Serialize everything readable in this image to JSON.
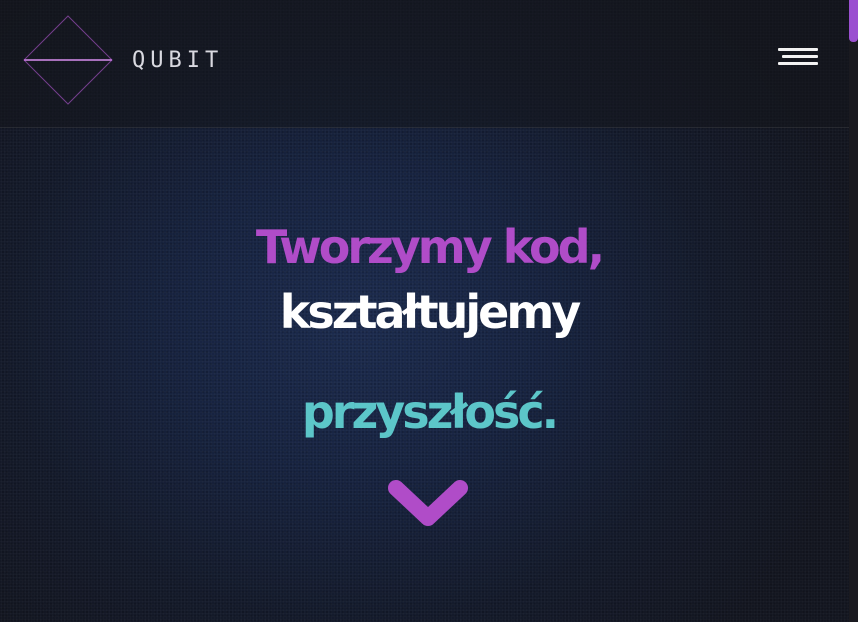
{
  "header": {
    "brand_name": "QUBIT",
    "logo_icon": "diamond-logo-icon",
    "menu_icon": "hamburger-menu-icon"
  },
  "hero": {
    "line1": "Tworzymy kod,",
    "line2": "kształtujemy",
    "line3": "przyszłość.",
    "scroll_icon": "chevron-down-icon"
  },
  "colors": {
    "accent_purple": "#b04cc8",
    "accent_teal": "#5cc6c9",
    "text_white": "#ffffff",
    "background": "#172340"
  }
}
